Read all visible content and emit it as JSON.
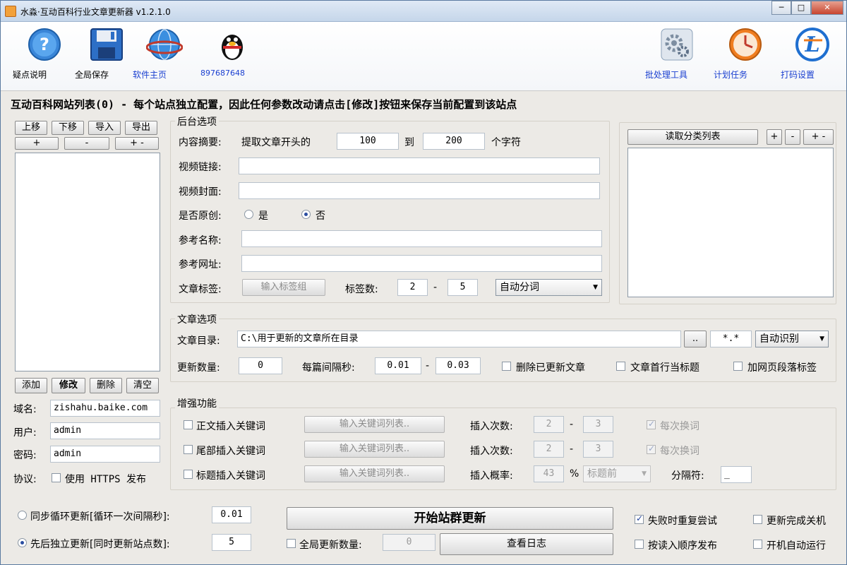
{
  "window": {
    "title": "水淼·互动百科行业文章更新器 v1.2.1.0"
  },
  "toolbar": {
    "help": "疑点说明",
    "save": "全局保存",
    "homepage": "软件主页",
    "qq": "897687648",
    "batch": "批处理工具",
    "schedule": "计划任务",
    "captcha": "打码设置"
  },
  "site_list": {
    "header": "互动百科网站列表(0) - 每个站点独立配置，因此任何参数改动请点击[修改]按钮来保存当前配置到该站点",
    "btn_up": "上移",
    "btn_down": "下移",
    "btn_import": "导入",
    "btn_export": "导出",
    "btn_plus": "+",
    "btn_minus": "-",
    "btn_plusminus": "+ -",
    "btn_add": "添加",
    "btn_modify": "修改",
    "btn_delete": "删除",
    "btn_clear": "清空",
    "domain_label": "域名:",
    "domain_value": "zishahu.baike.com",
    "user_label": "用户:",
    "user_value": "admin",
    "pass_label": "密码:",
    "pass_value": "admin",
    "proto_label": "协议:",
    "https_label": "使用 HTTPS 发布"
  },
  "backend": {
    "title": "后台选项",
    "summary_label": "内容摘要:",
    "summary_text": "提取文章开头的",
    "summary_from": "100",
    "summary_to_label": "到",
    "summary_to": "200",
    "summary_unit": "个字符",
    "video_link_label": "视频链接:",
    "video_cover_label": "视频封面:",
    "original_label": "是否原创:",
    "original_yes": "是",
    "original_no": "否",
    "ref_name_label": "参考名称:",
    "ref_url_label": "参考网址:",
    "tags_label": "文章标签:",
    "tags_btn": "输入标签组",
    "tag_count_label": "标签数:",
    "tag_min": "2",
    "tag_dash": "-",
    "tag_max": "5",
    "tag_mode": "自动分词"
  },
  "category": {
    "read_btn": "读取分类列表",
    "plus": "+",
    "minus": "-",
    "plusminus": "+ -"
  },
  "article": {
    "title": "文章选项",
    "dir_label": "文章目录:",
    "dir_value": "C:\\用于更新的文章所在目录",
    "browse": "..",
    "pattern": "*.*",
    "encoding": "自动识别",
    "count_label": "更新数量:",
    "count_value": "0",
    "interval_label": "每篇间隔秒:",
    "interval_min": "0.01",
    "interval_dash": "-",
    "interval_max": "0.03",
    "delete_updated": "删除已更新文章",
    "first_line_title": "文章首行当标题",
    "add_paragraph": "加网页段落标签"
  },
  "enhance": {
    "title": "增强功能",
    "body_kw": "正文插入关键词",
    "tail_kw": "尾部插入关键词",
    "title_kw": "标题插入关键词",
    "kw_btn": "输入关键词列表..",
    "insert_count_label": "插入次数:",
    "body_min": "2",
    "body_max": "3",
    "tail_min": "2",
    "tail_max": "3",
    "dash": "-",
    "change_each": "每次换词",
    "insert_rate_label": "插入概率:",
    "rate": "43",
    "percent": "%",
    "position": "标题前",
    "separator_label": "分隔符:",
    "separator": "_"
  },
  "bottom": {
    "sync_loop": "同步循环更新[循环一次间隔秒]:",
    "sync_value": "0.01",
    "seq_update": "先后独立更新[同时更新站点数]:",
    "seq_value": "5",
    "start_btn": "开始站群更新",
    "global_count": "全局更新数量:",
    "global_value": "0",
    "view_log": "查看日志",
    "retry": "失败时重复尝试",
    "shutdown": "更新完成关机",
    "order_publish": "按读入顺序发布",
    "autorun": "开机自动运行"
  },
  "colors": {
    "link": "#1a3fd0",
    "bg": "#eceae6"
  }
}
